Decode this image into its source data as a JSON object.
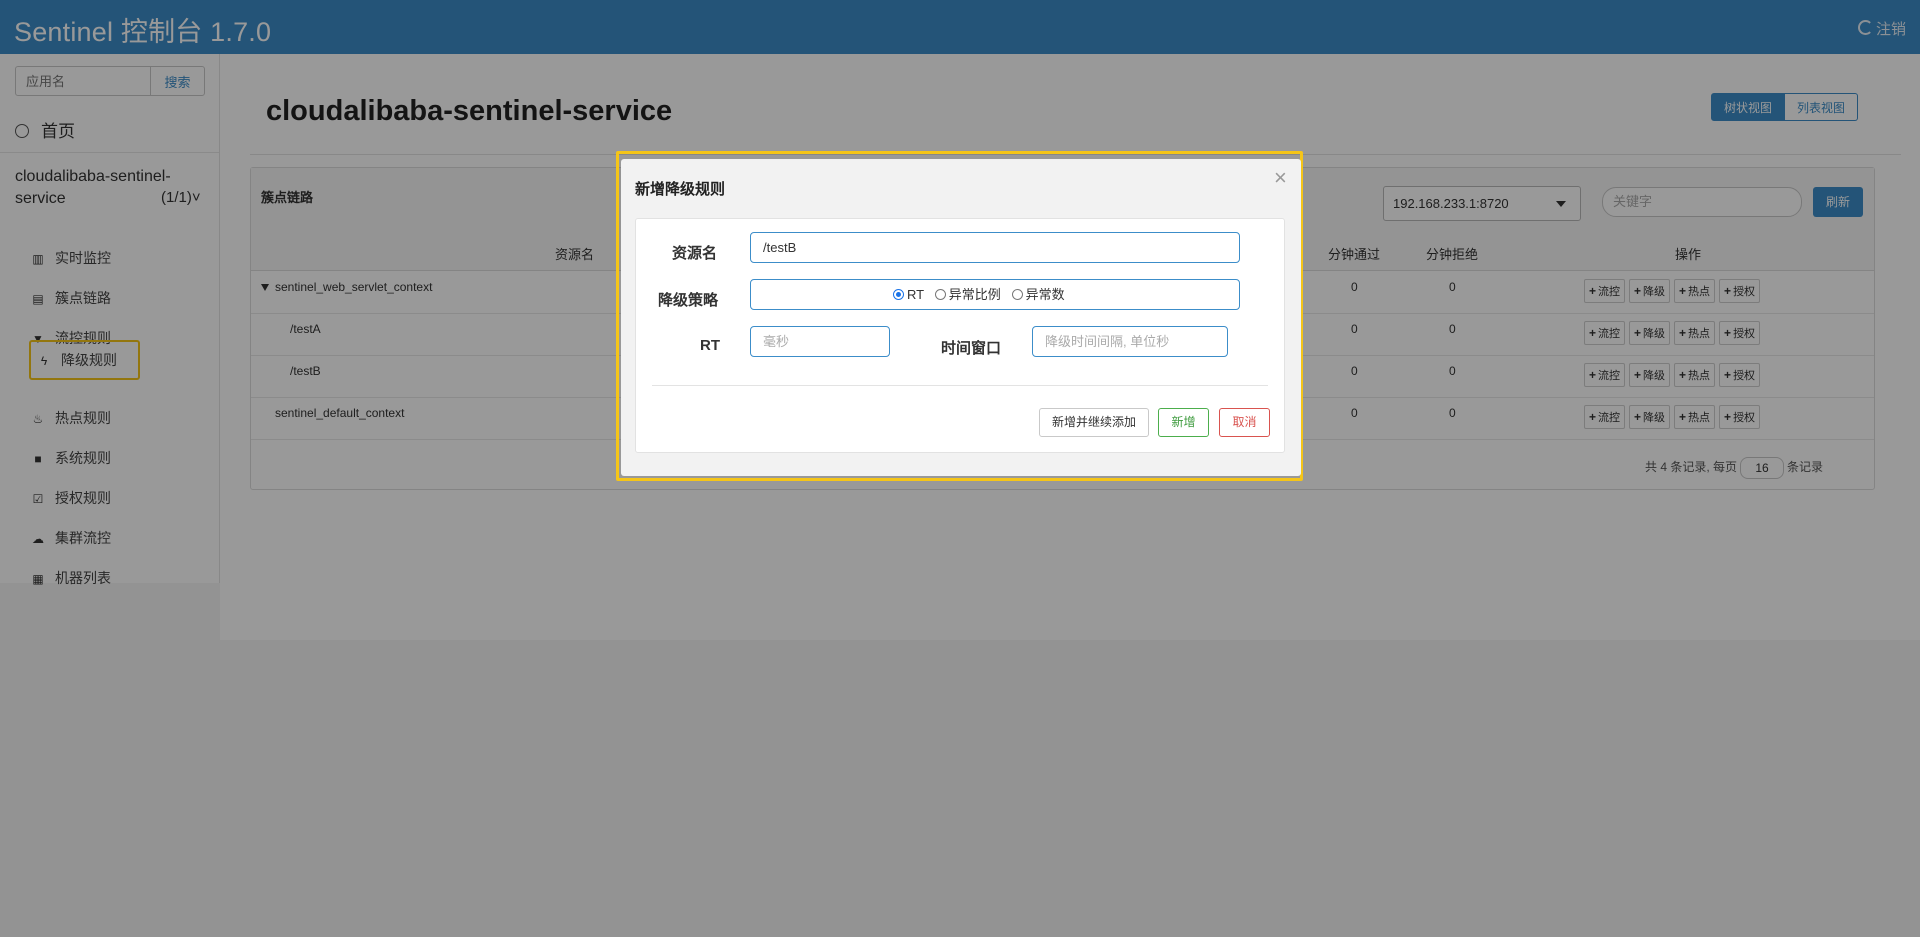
{
  "header": {
    "brand": "Sentinel 控制台 1.7.0",
    "logout_label": "注销"
  },
  "sidebar": {
    "search_placeholder": "应用名",
    "search_button": "搜索",
    "home_label": "首页",
    "app_name": "cloudalibaba-sentinel-service",
    "app_count": "(1/1)",
    "items": [
      {
        "label": "实时监控",
        "icon": "chart-icon"
      },
      {
        "label": "簇点链路",
        "icon": "list-icon"
      },
      {
        "label": "流控规则",
        "icon": "filter-icon"
      },
      {
        "label": "降级规则",
        "icon": "bolt-icon"
      },
      {
        "label": "热点规则",
        "icon": "fire-icon"
      },
      {
        "label": "系统规则",
        "icon": "lock-icon"
      },
      {
        "label": "授权规则",
        "icon": "check-icon"
      },
      {
        "label": "集群流控",
        "icon": "cloud-icon"
      },
      {
        "label": "机器列表",
        "icon": "table-icon"
      }
    ],
    "active_item": "降级规则"
  },
  "main": {
    "title": "cloudalibaba-sentinel-service",
    "view_tree": "树状视图",
    "view_list": "列表视图",
    "panel_title": "簇点链路",
    "machine": "192.168.233.1:8720",
    "keyword_placeholder": "关键字",
    "refresh": "刷新",
    "columns": {
      "resource": "资源名",
      "pass": "分钟通过",
      "block": "分钟拒绝",
      "ops": "操作"
    },
    "rows": [
      {
        "name": "sentinel_web_servlet_context",
        "pass": "0",
        "block": "0"
      },
      {
        "name": "/testA",
        "pass": "0",
        "block": "0"
      },
      {
        "name": "/testB",
        "pass": "0",
        "block": "0"
      },
      {
        "name": "sentinel_default_context",
        "pass": "0",
        "block": "0"
      }
    ],
    "op_labels": [
      "流控",
      "降级",
      "热点",
      "授权"
    ],
    "pager": {
      "prefix": "共 4 条记录, 每页",
      "page_size": "16",
      "suffix": "条记录"
    }
  },
  "modal": {
    "title": "新增降级规则",
    "resource_label": "资源名",
    "resource_value": "/testB",
    "strategy_label": "降级策略",
    "strategy_options": [
      "RT",
      "异常比例",
      "异常数"
    ],
    "strategy_selected": "RT",
    "rt_label": "RT",
    "rt_placeholder": "毫秒",
    "window_label": "时间窗口",
    "window_placeholder": "降级时间间隔, 单位秒",
    "btn_add_continue": "新增并继续添加",
    "btn_add": "新增",
    "btn_cancel": "取消"
  },
  "colors": {
    "primary": "#3c8dc9",
    "highlight": "#f5c518",
    "success": "#3c9a3c",
    "danger": "#d9534f"
  }
}
